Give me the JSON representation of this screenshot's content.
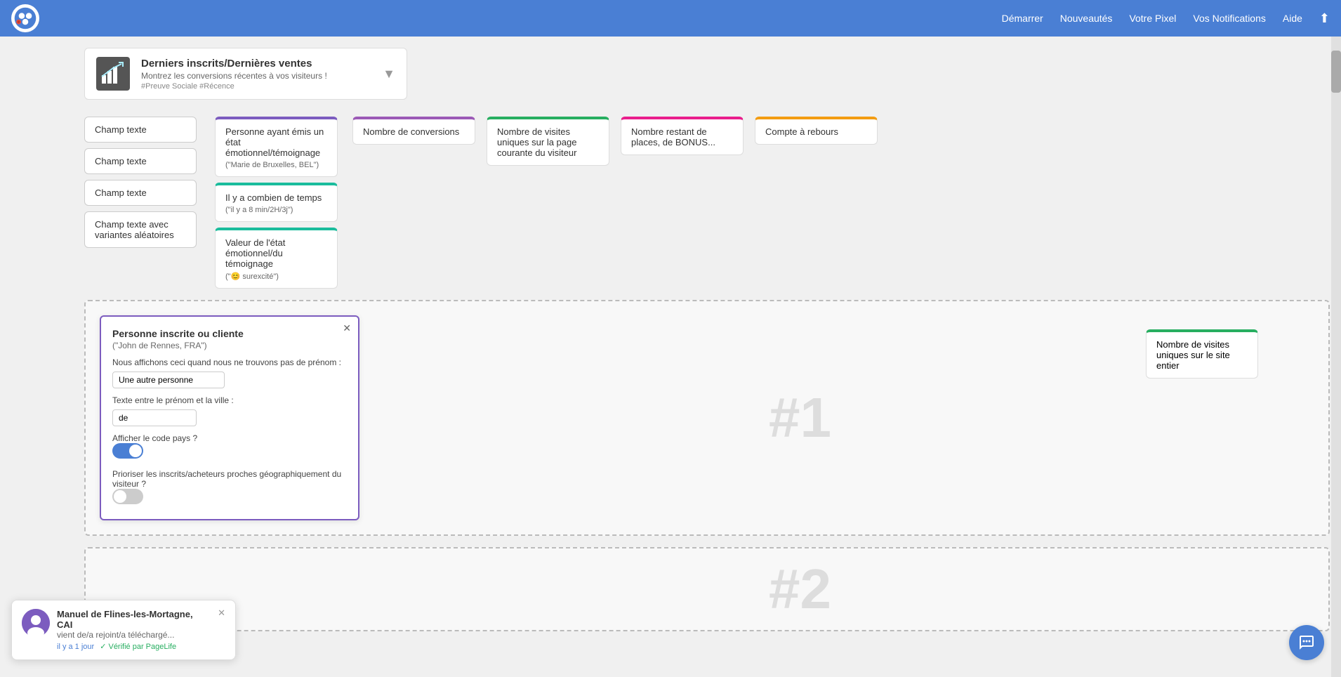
{
  "navbar": {
    "links": [
      {
        "id": "demarrer",
        "label": "Démarrer"
      },
      {
        "id": "nouveautes",
        "label": "Nouveautés"
      },
      {
        "id": "votre-pixel",
        "label": "Votre Pixel"
      },
      {
        "id": "vos-notifications",
        "label": "Vos Notifications"
      },
      {
        "id": "aide",
        "label": "Aide"
      }
    ],
    "export_icon": "⬛"
  },
  "top_card": {
    "title": "Derniers inscrits/Dernières ventes",
    "subtitle": "Montrez les conversions récentes à vos visiteurs !",
    "tags": "#Preuve Sociale #Récence",
    "chevron": "▼"
  },
  "blocks_row1": [
    {
      "id": "champ-texte-1",
      "label": "Champ texte",
      "type": "gray"
    },
    {
      "id": "champ-texte-2",
      "label": "Champ texte",
      "type": "gray"
    },
    {
      "id": "champ-texte-3",
      "label": "Champ texte",
      "type": "gray"
    },
    {
      "id": "champ-texte-variantes",
      "label": "Champ texte avec variantes aléatoires",
      "type": "gray"
    }
  ],
  "blocks_row2_purple": [
    {
      "id": "personne-etat",
      "label": "Personne ayant émis un état émotionnel/témoignage",
      "sub": "(\"Marie de Bruxelles, BEL\")",
      "color": "purple"
    },
    {
      "id": "il-y-a-combien",
      "label": "Il y a combien de temps",
      "sub": "(\"il y a 8 min/2H/3j\")",
      "color": "teal"
    },
    {
      "id": "valeur-etat",
      "label": "Valeur de l'état émotionnel/du témoignage",
      "sub": "(\"😊 surexcité\")",
      "color": "teal"
    }
  ],
  "blocks_row2_violet": [
    {
      "id": "nombre-conversions",
      "label": "Nombre de conversions",
      "color": "violet"
    }
  ],
  "blocks_row2_green": [
    {
      "id": "nombre-visites-page",
      "label": "Nombre de visites uniques sur la page courante du visiteur",
      "color": "green"
    }
  ],
  "blocks_row2_pink": [
    {
      "id": "nombre-places",
      "label": "Nombre restant de places, de BONUS...",
      "color": "pink"
    }
  ],
  "blocks_row2_orange": [
    {
      "id": "compte-rebours",
      "label": "Compte à rebours",
      "color": "orange"
    }
  ],
  "block_visites_site": {
    "id": "nombre-visites-site",
    "label": "Nombre de visites uniques sur le site entier",
    "color": "green2"
  },
  "popup": {
    "title": "Personne inscrite ou cliente",
    "subtitle": "(\"John de Rennes, FRA\")",
    "desc": "Nous affichons ceci quand nous ne trouvons pas de prénom :",
    "input1_placeholder": "Une autre personne",
    "input1_value": "Une autre personne",
    "label2": "Texte entre le prénom et la ville :",
    "input2_value": "de",
    "toggle1_label": "Afficher le code pays ?",
    "toggle1_state": "on",
    "toggle2_label": "Prioriser les inscrits/acheteurs proches géographiquement du visiteur ?",
    "toggle2_state": "off",
    "close_icon": "✕"
  },
  "dashed_areas": [
    {
      "number": "#1"
    },
    {
      "number": "#2"
    }
  ],
  "toast": {
    "name": "Manuel de Flines-les-Mortagne, CAI",
    "action": "vient de/a rejoint/a téléchargé...",
    "truncated": "/a télécha",
    "time": "il y a 1 jour",
    "verified": "✓ Vérifié par PageLife",
    "close_icon": "✕"
  },
  "chat_button": {
    "icon": "💬"
  }
}
